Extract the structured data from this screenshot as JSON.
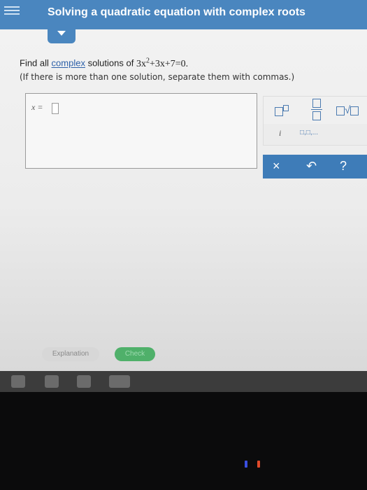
{
  "header": {
    "title": "Solving a quadratic equation with complex roots"
  },
  "question": {
    "prefix": "Find all ",
    "link": "complex",
    "middle": " solutions of ",
    "eq_a": "3x",
    "eq_exp": "2",
    "eq_b": "+3x+7=0.",
    "note": "(If there is more than one solution, separate them with commas.)"
  },
  "answer": {
    "label": "x ="
  },
  "keypad": {
    "imag_unit": "i",
    "list_key": "□,□,...",
    "clear": "×",
    "undo": "↶",
    "help": "?"
  },
  "buttons": {
    "explanation": "Explanation",
    "check": "Check"
  },
  "colors": {
    "header": "#4a86bf",
    "action_bar": "#3e7cb8",
    "check": "#4fb06a"
  }
}
